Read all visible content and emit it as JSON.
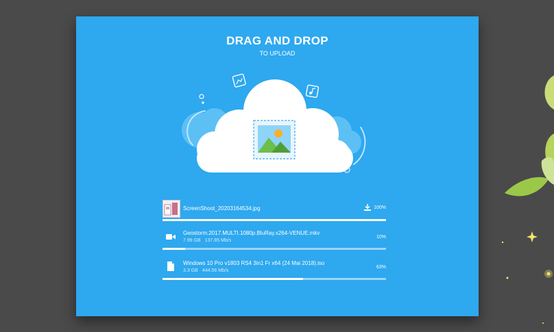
{
  "header": {
    "title": "DRAG AND DROP",
    "subtitle": "TO UPLOAD"
  },
  "dropzone": {
    "icon": "image-icon"
  },
  "files": [
    {
      "name": "ScreenShoot_20203164534.jpg",
      "percent_label": "100%",
      "progress": 1.0,
      "icon": "image-thumbnail",
      "status_icon": "download-icon"
    },
    {
      "name": "Geostorm.2017.MULTI.1080p.BluRay.x264-VENUE.mkv",
      "size": "7.99 GB",
      "speed": "137.85 Mb/s",
      "percent_label": "10%",
      "progress": 0.1,
      "icon": "video-camera-icon"
    },
    {
      "name": "Windows 10 Pro v1803 RS4 3in1 Fr x64 (24 Mai 2018).iso",
      "size": "3.3 GB",
      "speed": "444.56 Mb/s",
      "percent_label": "63%",
      "progress": 0.63,
      "icon": "file-icon"
    }
  ],
  "colors": {
    "panel": "#2ea8ef",
    "background": "#4a4a4a",
    "progress_fill": "#ffffff",
    "progress_track": "#9fd4f6"
  }
}
